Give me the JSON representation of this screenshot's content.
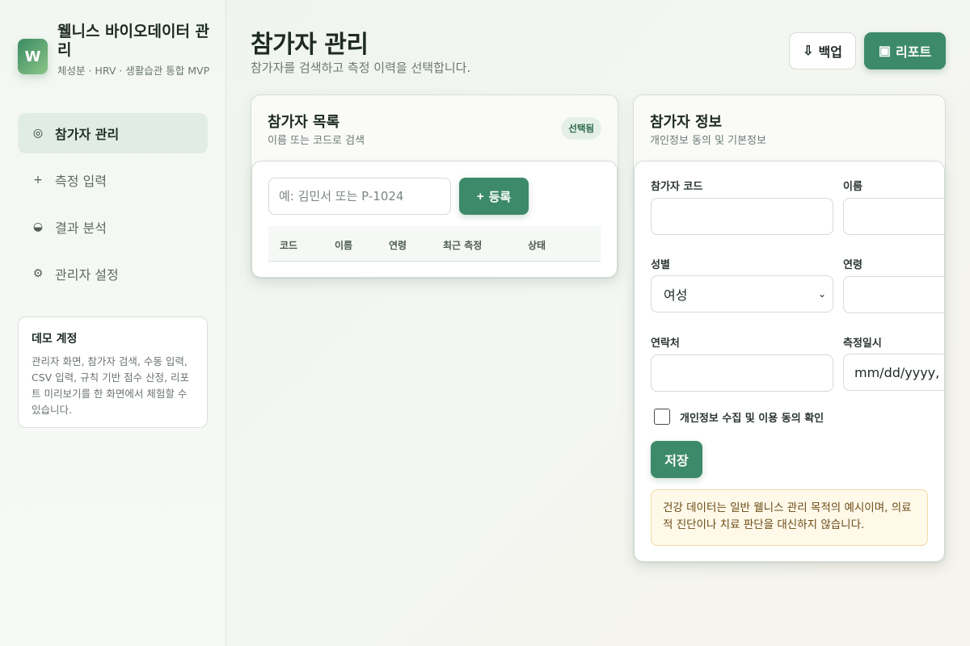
{
  "brand": {
    "logo_letter": "W",
    "title": "웰니스 바이오데이터 관리",
    "subtitle": "체성분 · HRV · 생활습관 통합 MVP"
  },
  "nav": {
    "items": [
      {
        "icon": "◎",
        "icon_name": "target-icon",
        "label": "참가자 관리",
        "active": true
      },
      {
        "icon": "+",
        "icon_name": "plus-icon",
        "label": "측정 입력",
        "active": false
      },
      {
        "icon": "◒",
        "icon_name": "half-circle-icon",
        "label": "결과 분석",
        "active": false
      },
      {
        "icon": "⚙",
        "icon_name": "gear-icon",
        "label": "관리자 설정",
        "active": false
      }
    ]
  },
  "demo": {
    "title": "데모 계정",
    "text": "관리자 화면, 참가자 검색, 수동 입력, CSV 입력, 규칙 기반 점수 산정, 리포트 미리보기를 한 화면에서 체험할 수 있습니다."
  },
  "header": {
    "title": "참가자 관리",
    "subtitle": "참가자를 검색하고 측정 이력을 선택합니다.",
    "backup_icon": "⇩",
    "backup_label": "백업",
    "report_icon": "▣",
    "report_label": "리포트"
  },
  "list_panel": {
    "title": "참가자 목록",
    "desc": "이름 또는 코드로 검색",
    "badge": "선택됨",
    "search_placeholder": "예: 김민서 또는 P-1024",
    "register_icon": "+",
    "register_label": "등록",
    "columns": [
      "코드",
      "이름",
      "연령",
      "최근 측정",
      "상태"
    ]
  },
  "info_panel": {
    "title": "참가자 정보",
    "desc": "개인정보 동의 및 기본정보",
    "code_label": "참가자 코드",
    "name_label": "이름",
    "gender_label": "성별",
    "gender_value": "여성",
    "age_label": "연령",
    "contact_label": "연락처",
    "date_label": "측정일시",
    "date_value": "mm/dd/yyyy, --:-- --",
    "consent_label": "개인정보 수집 및 이용 동의 확인",
    "save_label": "저장",
    "notice": "건강 데이터는 일반 웰니스 관리 목적의 예시이며, 의료적 진단이나 치료 판단을 대신하지 않습니다."
  },
  "colors": {
    "accent": "#3d8a6a",
    "badge_bg": "#e4f0e7",
    "notice_bg": "#fff9ea",
    "notice_text": "#6b4a14"
  }
}
